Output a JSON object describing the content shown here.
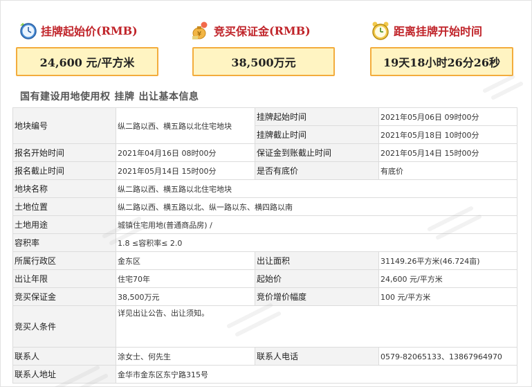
{
  "cards": [
    {
      "title": "挂牌起始价",
      "unit": "(RMB)",
      "value": "24,600 元/平方米",
      "icon": "clock-icon"
    },
    {
      "title": "竞买保证金",
      "unit": "(RMB)",
      "value": "38,500万元",
      "icon": "money-bag-icon"
    },
    {
      "title": "距离挂牌开始时间",
      "unit": "",
      "value": "19天18小时26分26秒",
      "icon": "alarm-clock-icon"
    }
  ],
  "section": {
    "title": "国有建设用地使用权",
    "tag": "挂牌",
    "suffix": "出让基本信息"
  },
  "table": {
    "plot_no_label": "地块编号",
    "plot_no": "纵二路以西、横五路以北住宅地块",
    "listing_start_label": "挂牌起始时间",
    "listing_start": "2021年05月06日 09时00分",
    "listing_end_label": "挂牌截止时间",
    "listing_end": "2021年05月18日 10时00分",
    "signup_start_label": "报名开始时间",
    "signup_start": "2021年04月16日 08时00分",
    "deposit_deadline_label": "保证金到账截止时间",
    "deposit_deadline": "2021年05月14日 15时00分",
    "signup_end_label": "报名截止时间",
    "signup_end": "2021年05月14日 15时00分",
    "reserve_label": "是否有底价",
    "reserve": "有底价",
    "plot_name_label": "地块名称",
    "plot_name": "纵二路以西、横五路以北住宅地块",
    "location_label": "土地位置",
    "location": "纵二路以西、横五路以北、纵一路以东、横四路以南",
    "usage_label": "土地用途",
    "usage": "城镇住宅用地(普通商品房) /",
    "far_label": "容积率",
    "far": "1.8 ≤容积率≤ 2.0",
    "district_label": "所属行政区",
    "district": "金东区",
    "area_label": "出让面积",
    "area": "31149.26平方米(46.724亩)",
    "term_label": "出让年限",
    "term": "住宅70年",
    "start_price_label": "起始价",
    "start_price": "24,600 元/平方米",
    "bid_deposit_label": "竞买保证金",
    "bid_deposit": "38,500万元",
    "increment_label": "竞价增价幅度",
    "increment": "100 元/平方米",
    "conditions_label": "竞买人条件",
    "conditions": "详见出让公告、出让须知。",
    "contact_label": "联系人",
    "contact": "涂女士、何先生",
    "phone_label": "联系人电话",
    "phone": "0579-82065133、13867964970",
    "address_label": "联系人地址",
    "address": "金华市金东区东宁路315号"
  },
  "colors": {
    "accent_red": "#c0242a",
    "card_bg": "#fff4c2",
    "card_border": "#f3ac3c",
    "label_bg": "#f3f3f3"
  }
}
